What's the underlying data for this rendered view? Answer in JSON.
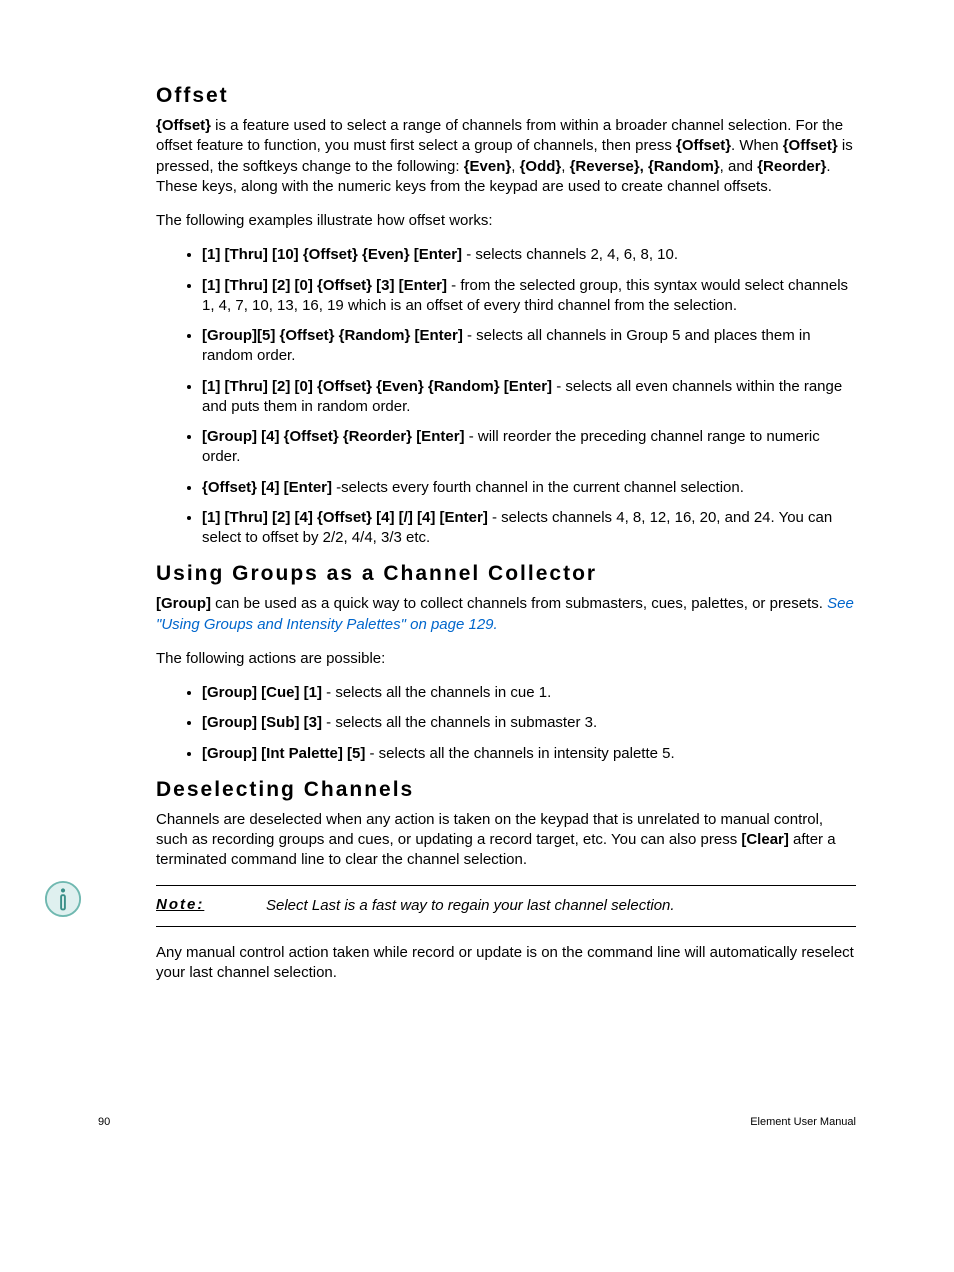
{
  "sections": {
    "offset": {
      "heading": "Offset",
      "p1_parts": [
        {
          "b": true,
          "t": "{Offset}"
        },
        {
          "b": false,
          "t": " is a feature used to select a range of channels from within a broader channel selection. For the offset feature to function, you must first select a group of channels, then press "
        },
        {
          "b": true,
          "t": "{Offset}"
        },
        {
          "b": false,
          "t": ". When "
        },
        {
          "b": true,
          "t": "{Offset}"
        },
        {
          "b": false,
          "t": " is pressed, the softkeys change to the following: "
        },
        {
          "b": true,
          "t": "{Even}"
        },
        {
          "b": false,
          "t": ", "
        },
        {
          "b": true,
          "t": "{Odd}"
        },
        {
          "b": false,
          "t": ", "
        },
        {
          "b": true,
          "t": "{Reverse}, {Random}"
        },
        {
          "b": false,
          "t": ", and "
        },
        {
          "b": true,
          "t": "{Reorder}"
        },
        {
          "b": false,
          "t": ". These keys, along with the numeric keys from the keypad are used to create channel offsets."
        }
      ],
      "p2": "The following examples illustrate how offset works:",
      "bullets": [
        {
          "bold": "[1] [Thru] [10] {Offset} {Even} [Enter]",
          "rest": " - selects channels 2, 4, 6, 8, 10."
        },
        {
          "bold": "[1] [Thru] [2] [0] {Offset} [3] [Enter]",
          "rest": " - from the selected group, this syntax would select channels 1, 4, 7, 10, 13, 16, 19 which is an offset of every third channel from the selection."
        },
        {
          "bold": "[Group][5] {Offset} {Random} [Enter]",
          "rest": " - selects all channels in Group 5 and places them in random order."
        },
        {
          "bold": "[1] [Thru] [2] [0] {Offset} {Even} {Random} [Enter]",
          "rest": " - selects all even channels within the range and puts them in random order."
        },
        {
          "bold": "[Group] [4] {Offset} {Reorder} [Enter]",
          "rest": " - will reorder the preceding channel range to numeric order."
        },
        {
          "bold": "{Offset} [4] [Enter]",
          "rest": " -selects every fourth channel in the current channel selection."
        },
        {
          "bold": "[1] [Thru] [2] [4] {Offset} [4] [/] [4] [Enter]",
          "rest": " - selects channels 4, 8, 12, 16, 20, and 24. You can select to offset by 2/2, 4/4, 3/3 etc."
        }
      ]
    },
    "groups": {
      "heading": "Using Groups as a Channel Collector",
      "p1_prefix_bold": "[Group]",
      "p1_mid": " can be used as a quick way to collect channels from submasters, cues, palettes, or presets. ",
      "p1_link": "See \"Using Groups and Intensity Palettes\" on page 129.",
      "p2": "The following actions are possible:",
      "bullets": [
        {
          "bold": "[Group] [Cue] [1]",
          "rest": " - selects all the channels in cue 1."
        },
        {
          "bold": "[Group] [Sub] [3]",
          "rest": " - selects all the channels in submaster 3."
        },
        {
          "bold": "[Group] [Int Palette] [5]",
          "rest": " - selects all the channels in intensity palette 5."
        }
      ]
    },
    "deselect": {
      "heading": "Deselecting Channels",
      "p1_pre": "Channels are deselected when any action is taken on the keypad that is unrelated to manual control, such as recording groups and cues, or updating a record target, etc. You can also press ",
      "p1_bold": "[Clear]",
      "p1_post": " after a terminated command line to clear the channel selection.",
      "note_label": "Note:",
      "note_text": "Select Last is a fast way to regain your last channel selection.",
      "p2": "Any manual control action taken while record or update is on the command line will automatically reselect your last channel selection."
    }
  },
  "footer": {
    "page": "90",
    "title": "Element User Manual"
  }
}
